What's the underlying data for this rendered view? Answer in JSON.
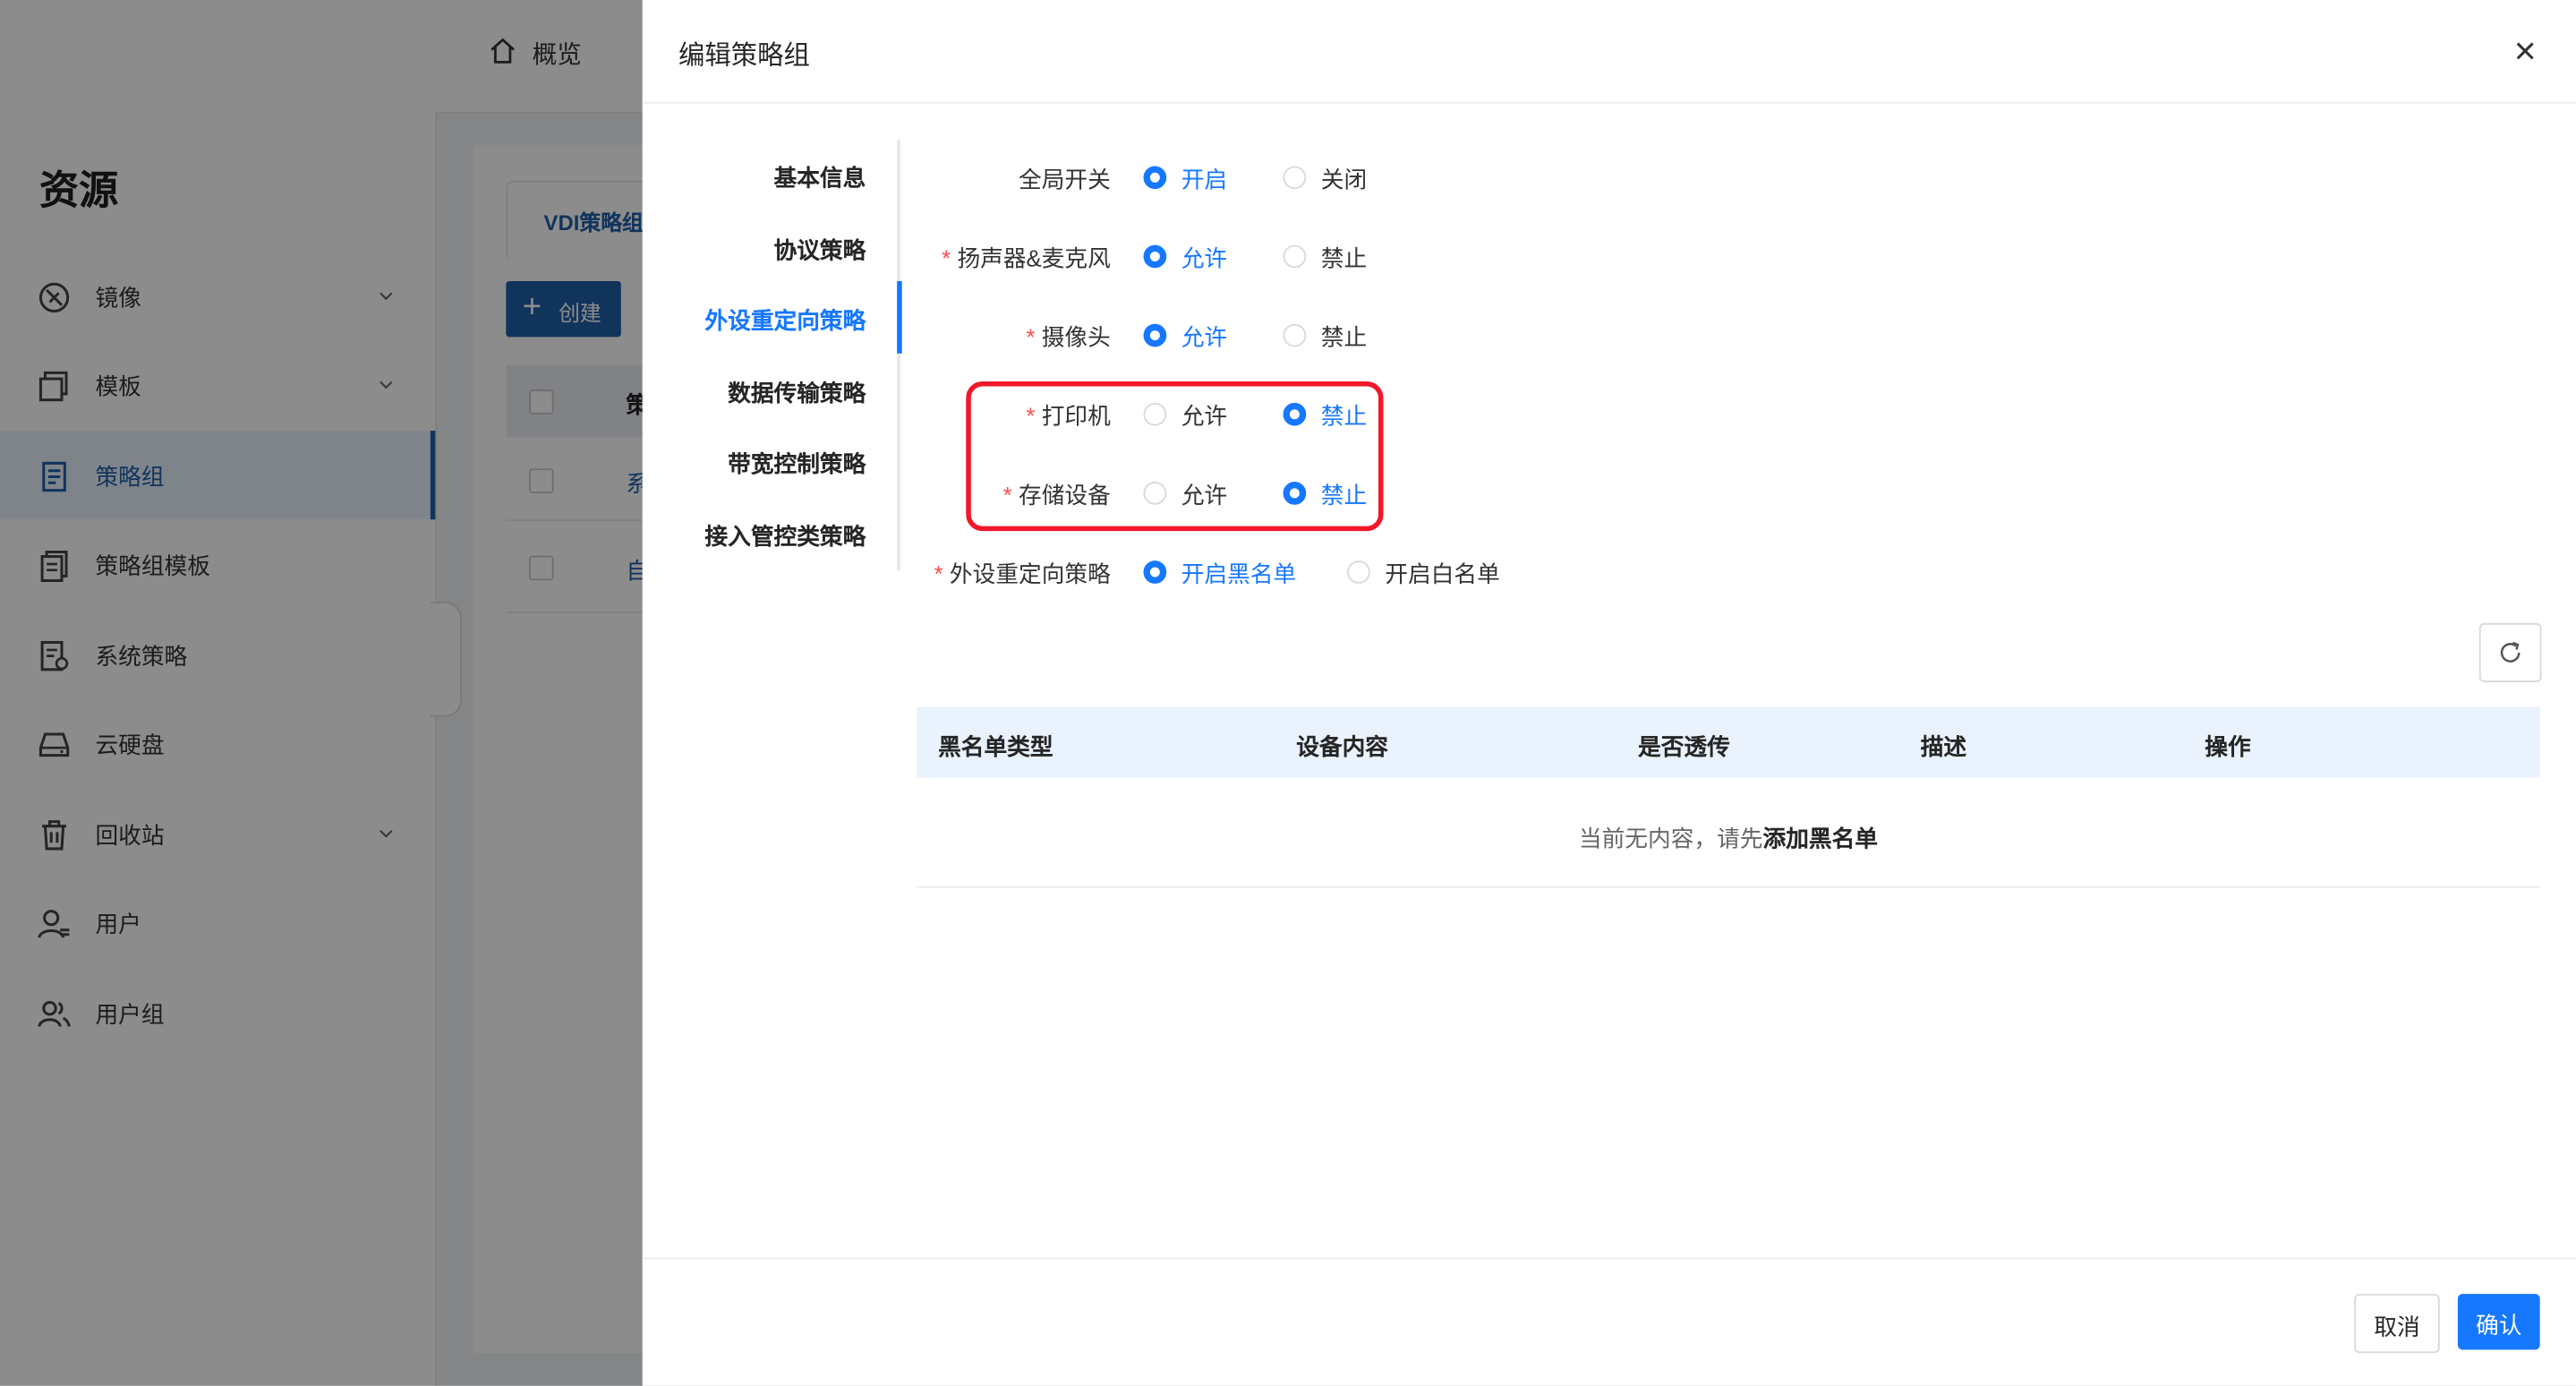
{
  "app": {
    "top_nav": {
      "overview_label": "概览"
    },
    "sidebar": {
      "title": "资源",
      "items": [
        {
          "label": "镜像",
          "has_chevron": true,
          "icon": "image-icon"
        },
        {
          "label": "模板",
          "has_chevron": true,
          "icon": "template-icon"
        },
        {
          "label": "策略组",
          "has_chevron": false,
          "icon": "policy-group-icon",
          "active": true
        },
        {
          "label": "策略组模板",
          "has_chevron": false,
          "icon": "policy-template-icon"
        },
        {
          "label": "系统策略",
          "has_chevron": false,
          "icon": "system-policy-icon"
        },
        {
          "label": "云硬盘",
          "has_chevron": false,
          "icon": "cloud-disk-icon"
        },
        {
          "label": "回收站",
          "has_chevron": true,
          "icon": "trash-icon"
        },
        {
          "label": "用户",
          "has_chevron": false,
          "icon": "user-icon"
        },
        {
          "label": "用户组",
          "has_chevron": false,
          "icon": "user-group-icon"
        }
      ]
    },
    "main": {
      "tab_label": "VDI策略组",
      "create_button_label": "创建",
      "row_stubs": [
        "策",
        "系",
        "自"
      ]
    }
  },
  "drawer": {
    "title": "编辑策略组",
    "anchors": [
      {
        "label": "基本信息",
        "active": false
      },
      {
        "label": "协议策略",
        "active": false
      },
      {
        "label": "外设重定向策略",
        "active": true
      },
      {
        "label": "数据传输策略",
        "active": false
      },
      {
        "label": "带宽控制策略",
        "active": false
      },
      {
        "label": "接入管控类策略",
        "active": false
      }
    ],
    "form": {
      "rows": [
        {
          "label": "全局开关",
          "required": false,
          "options": [
            "开启",
            "关闭"
          ],
          "selected": 0
        },
        {
          "label": "扬声器&麦克风",
          "required": true,
          "options": [
            "允许",
            "禁止"
          ],
          "selected": 0
        },
        {
          "label": "摄像头",
          "required": true,
          "options": [
            "允许",
            "禁止"
          ],
          "selected": 0
        },
        {
          "label": "打印机",
          "required": true,
          "options": [
            "允许",
            "禁止"
          ],
          "selected": 1
        },
        {
          "label": "存储设备",
          "required": true,
          "options": [
            "允许",
            "禁止"
          ],
          "selected": 1
        },
        {
          "label": "外设重定向策略",
          "required": true,
          "options": [
            "开启黑名单",
            "开启白名单"
          ],
          "selected": 0
        }
      ]
    },
    "blacklist_table": {
      "columns": [
        "黑名单类型",
        "设备内容",
        "是否透传",
        "描述",
        "操作"
      ],
      "empty_prefix": "当前无内容，请先",
      "empty_action": "添加黑名单"
    },
    "footer": {
      "cancel_label": "取消",
      "confirm_label": "确认"
    }
  },
  "colors": {
    "accent": "#1677ff",
    "highlight_border": "#f2182a"
  }
}
